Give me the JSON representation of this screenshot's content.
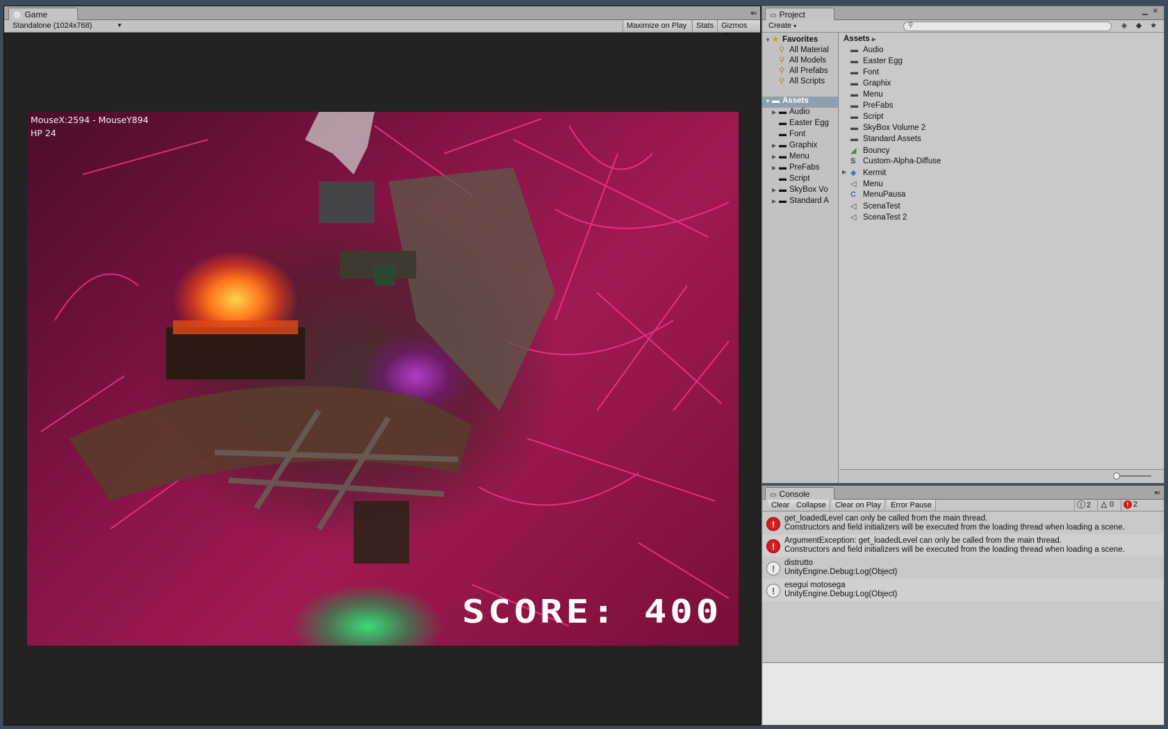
{
  "game": {
    "tab_label": "Game",
    "resolution": "Standalone (1024x768)",
    "buttons": {
      "maximize": "Maximize on Play",
      "stats": "Stats",
      "gizmos": "Gizmos"
    },
    "hud": {
      "mouse": "MouseX:2594 - MouseY894",
      "hp": "HP 24",
      "score": "SCORE: 400"
    }
  },
  "project": {
    "tab_label": "Project",
    "create_label": "Create",
    "search_placeholder": "",
    "tree": {
      "favorites_label": "Favorites",
      "favorites": [
        "All Material",
        "All Models",
        "All Prefabs",
        "All Scripts"
      ],
      "assets_label": "Assets",
      "assets": [
        "Audio",
        "Easter Egg",
        "Font",
        "Graphix",
        "Menu",
        "PreFabs",
        "Script",
        "SkyBox Vo",
        "Standard A"
      ]
    },
    "breadcrumb": "Assets",
    "items": [
      {
        "name": "Audio",
        "icon": "folder-icon"
      },
      {
        "name": "Easter Egg",
        "icon": "folder-icon"
      },
      {
        "name": "Font",
        "icon": "folder-icon"
      },
      {
        "name": "Graphix",
        "icon": "folder-icon"
      },
      {
        "name": "Menu",
        "icon": "folder-icon"
      },
      {
        "name": "PreFabs",
        "icon": "folder-icon"
      },
      {
        "name": "Script",
        "icon": "folder-icon"
      },
      {
        "name": "SkyBox Volume 2",
        "icon": "folder-icon"
      },
      {
        "name": "Standard Assets",
        "icon": "folder-icon"
      },
      {
        "name": "Bouncy",
        "icon": "physics-material-icon"
      },
      {
        "name": "Custom-Alpha-Diffuse",
        "icon": "shader-icon"
      },
      {
        "name": "Kermit",
        "icon": "model-icon"
      },
      {
        "name": "Menu",
        "icon": "unity-scene-icon"
      },
      {
        "name": "MenuPausa",
        "icon": "script-icon"
      },
      {
        "name": "ScenaTest",
        "icon": "unity-scene-icon"
      },
      {
        "name": "ScenaTest 2",
        "icon": "unity-scene-icon"
      }
    ]
  },
  "console": {
    "tab_label": "Console",
    "buttons": {
      "clear": "Clear",
      "collapse": "Collapse",
      "clear_on_play": "Clear on Play",
      "error_pause": "Error Pause"
    },
    "counts": {
      "info": "2",
      "warnings": "0",
      "errors": "2"
    },
    "logs": [
      {
        "type": "error",
        "line1": "get_loadedLevel can only be called from the main thread.",
        "line2": "Constructors and field initializers will be executed from the loading thread when loading a scene."
      },
      {
        "type": "error",
        "line1": "ArgumentException: get_loadedLevel can only be called from the main thread.",
        "line2": "Constructors and field initializers will be executed from the loading thread when loading a scene."
      },
      {
        "type": "info",
        "line1": "distrutto",
        "line2": "UnityEngine.Debug:Log(Object)"
      },
      {
        "type": "info",
        "line1": "esegui motosega",
        "line2": "UnityEngine.Debug:Log(Object)"
      }
    ]
  },
  "colors": {
    "error": "#d51c1c",
    "game_bg": "#232323",
    "panel_bg": "#c2c2c2"
  }
}
